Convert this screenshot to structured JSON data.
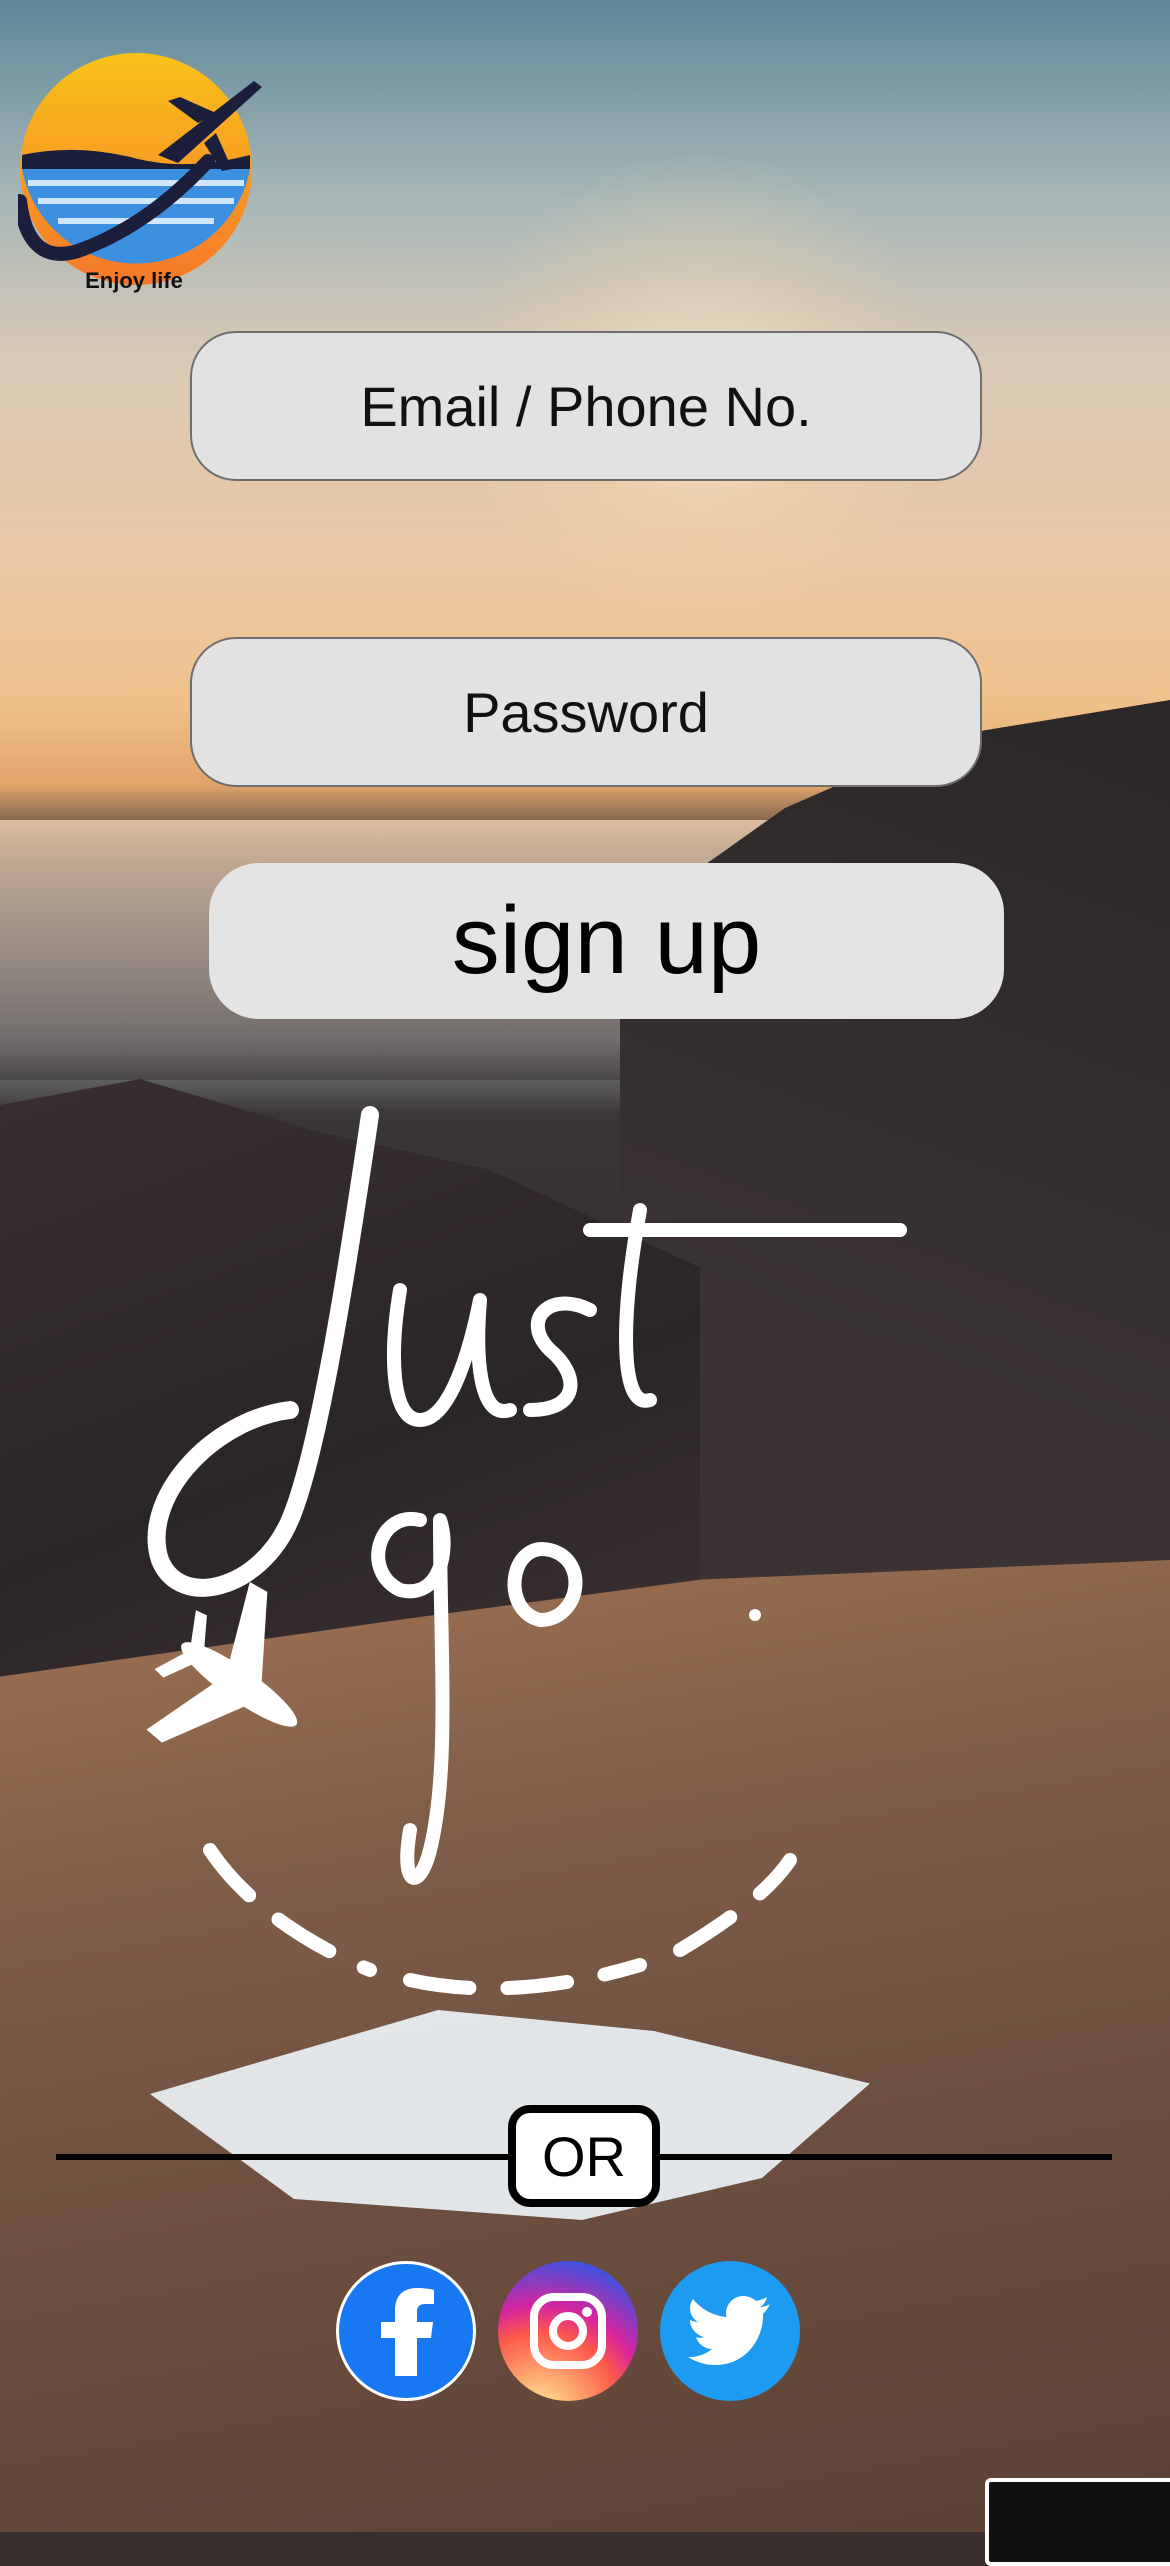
{
  "app": {
    "logo_caption": "Enjoy life"
  },
  "form": {
    "email_placeholder": "Email / Phone No.",
    "password_placeholder": "Password",
    "signup_label": "sign up"
  },
  "slogan": {
    "line1": "Just",
    "line2": "go."
  },
  "divider": {
    "label": "OR"
  },
  "social": {
    "facebook_icon": "facebook-icon",
    "instagram_icon": "instagram-icon",
    "twitter_icon": "twitter-icon"
  },
  "colors": {
    "field_bg": "#e2e2e2",
    "facebook": "#1877f2",
    "twitter": "#1d9bf0"
  }
}
